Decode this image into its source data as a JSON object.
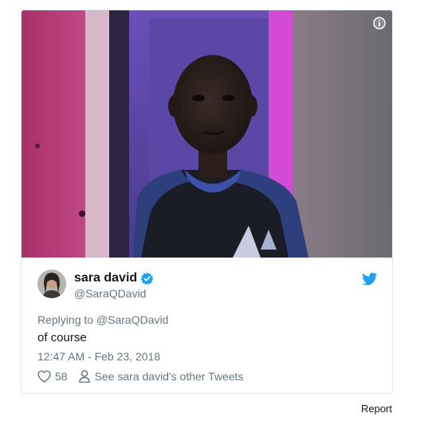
{
  "tweet": {
    "display_name": "sara david",
    "handle": "@SaraQDavid",
    "replying_prefix": "Replying to",
    "replying_to": "@SaraQDavid",
    "text": "of course",
    "timestamp": "12:47 AM - Feb 23, 2018",
    "like_count": "58",
    "other_tweets_label": "See sara david's other Tweets"
  },
  "footer": {
    "report_label": "Report"
  },
  "colors": {
    "accent": "#1da1f2",
    "secondary_text": "#657786",
    "primary_text": "#14171a",
    "border": "#e1e8ed"
  },
  "icons": {
    "info": "info-icon",
    "verified": "verified-badge-icon",
    "brand": "twitter-bird-icon",
    "like": "heart-icon",
    "profile": "person-icon"
  }
}
